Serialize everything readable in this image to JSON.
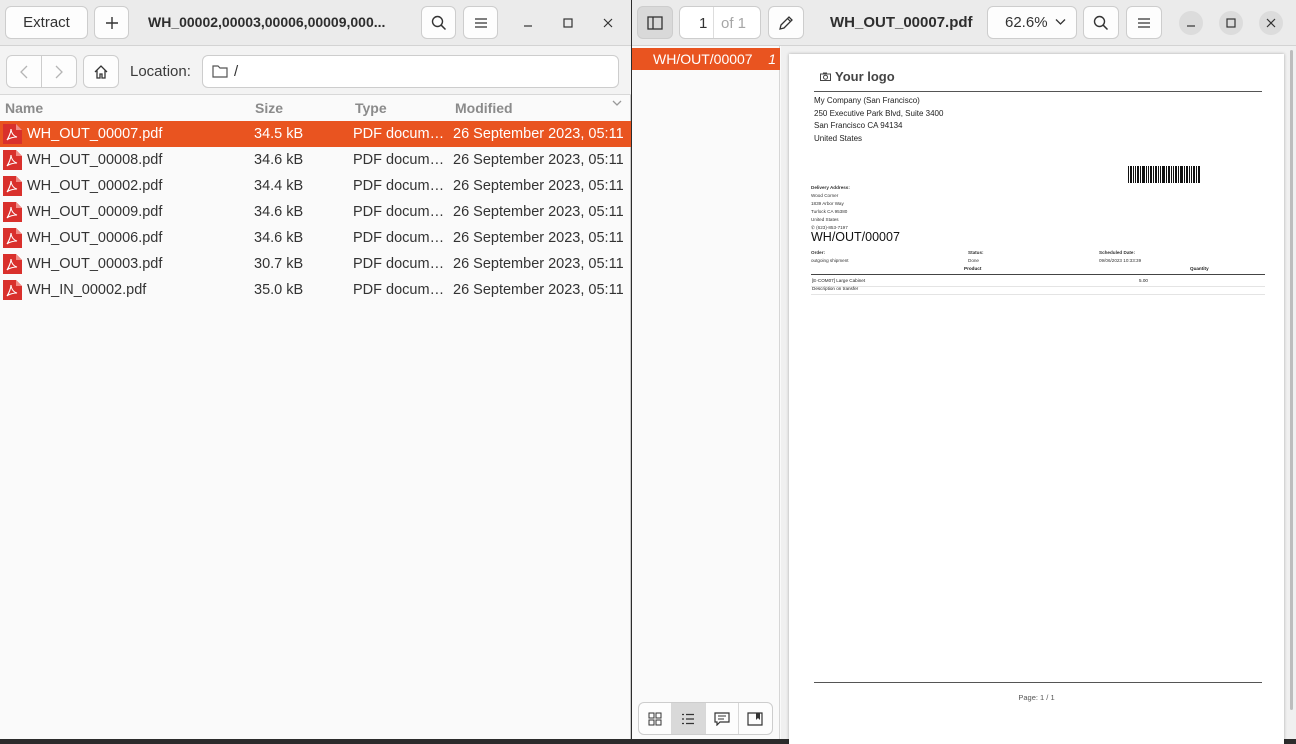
{
  "archive_window": {
    "title": "WH_00002,00003,00006,00009,000...",
    "extract_label": "Extract",
    "location_label": "Location:",
    "location_value": "/",
    "columns": {
      "name": "Name",
      "size": "Size",
      "type": "Type",
      "modified": "Modified"
    },
    "files": [
      {
        "name": "WH_OUT_00007.pdf",
        "size": "34.5 kB",
        "type": "PDF document",
        "modified": "26 September 2023, 05:11",
        "selected": true
      },
      {
        "name": "WH_OUT_00008.pdf",
        "size": "34.6 kB",
        "type": "PDF document",
        "modified": "26 September 2023, 05:11"
      },
      {
        "name": "WH_OUT_00002.pdf",
        "size": "34.4 kB",
        "type": "PDF document",
        "modified": "26 September 2023, 05:11"
      },
      {
        "name": "WH_OUT_00009.pdf",
        "size": "34.6 kB",
        "type": "PDF document",
        "modified": "26 September 2023, 05:11"
      },
      {
        "name": "WH_OUT_00006.pdf",
        "size": "34.6 kB",
        "type": "PDF document",
        "modified": "26 September 2023, 05:11"
      },
      {
        "name": "WH_OUT_00003.pdf",
        "size": "30.7 kB",
        "type": "PDF document",
        "modified": "26 September 2023, 05:11"
      },
      {
        "name": "WH_IN_00002.pdf",
        "size": "35.0 kB",
        "type": "PDF document",
        "modified": "26 September 2023, 05:11"
      }
    ]
  },
  "viewer_window": {
    "page_current": "1",
    "page_of": "of 1",
    "title": "WH_OUT_00007.pdf",
    "zoom": "62.6%",
    "outline": {
      "label": "WH/OUT/00007",
      "page": "1"
    }
  },
  "document": {
    "logo_text": "Your logo",
    "company_lines": [
      "My Company (San Francisco)",
      "250 Executive Park Blvd, Suite 3400",
      "San Francisco CA 94134",
      "United States"
    ],
    "delivery_label": "Delivery Address:",
    "delivery_lines": [
      "Wood Corner",
      "1839 Arbor Way",
      "Turlock CA 95380",
      "United States",
      "✆ (623)-853-7197"
    ],
    "reference": "WH/OUT/00007",
    "order_label": "Order:",
    "order_value": "outgoing shipment",
    "status_label": "Status:",
    "status_value": "Done",
    "scheduled_label": "Scheduled Date:",
    "scheduled_value": "09/06/2023 10:33:39",
    "th_product": "Product",
    "th_quantity": "Quantity",
    "row_product": "[E-COM07] Large Cabinet",
    "row_qty": "5.00",
    "row_desc": "Description on transfer",
    "footer": "Page: 1 / 1"
  },
  "colors": {
    "accent": "#e95420",
    "pdf_icon": "#d9302c"
  },
  "icons": [
    "plus-icon",
    "search-icon",
    "hamburger-menu-icon",
    "minimize-icon",
    "maximize-icon",
    "close-icon",
    "chevron-left-icon",
    "chevron-right-icon",
    "home-icon",
    "folder-icon",
    "sort-chevron-icon",
    "pdf-file-icon",
    "sidebar-icon",
    "pencil-icon",
    "chevron-down-icon",
    "thumbnails-icon",
    "outline-list-icon",
    "annotations-icon",
    "bookmarks-icon",
    "camera-icon"
  ]
}
